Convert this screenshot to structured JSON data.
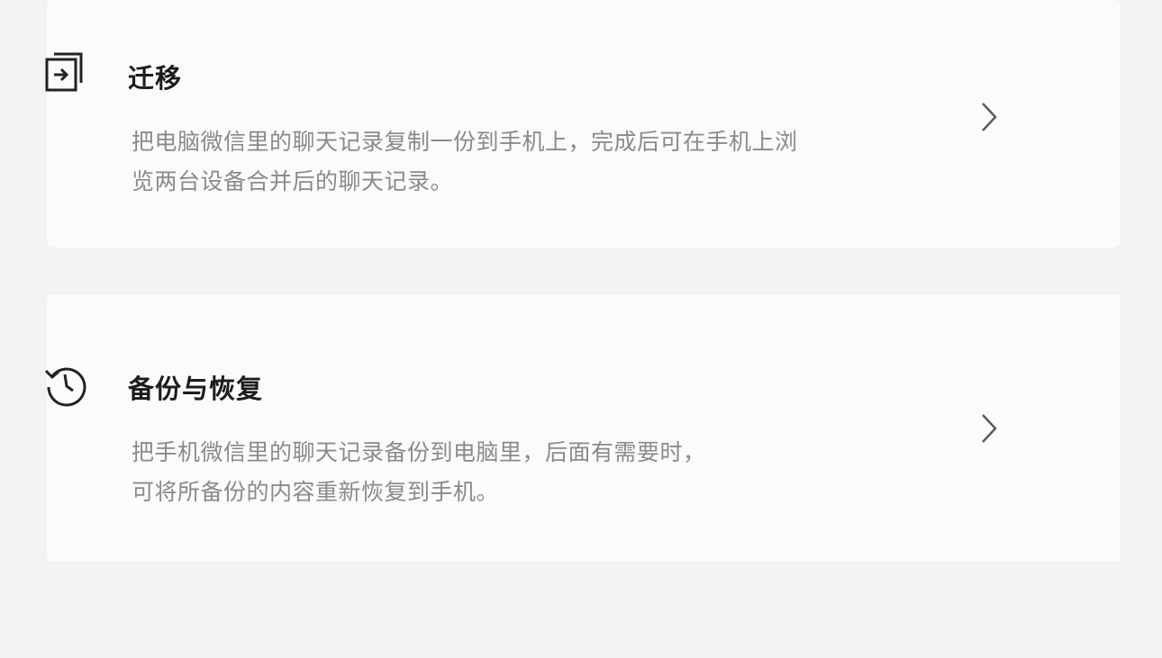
{
  "colors": {
    "background": "#f3f3f5",
    "card": "#fbfbfd",
    "title": "#1c1c1c",
    "description": "#8a8a8a",
    "chevron": "#5a5a5a"
  },
  "options": [
    {
      "icon": "migrate-icon",
      "title": "迁移",
      "description_lines": [
        "把电脑微信里的聊天记录复制一份到手机上，完成后可在手机上浏",
        "览两台设备合并后的聊天记录。"
      ]
    },
    {
      "icon": "history-clock-icon",
      "title": "备份与恢复",
      "description_lines": [
        "把手机微信里的聊天记录备份到电脑里，后面有需要时，",
        "可将所备份的内容重新恢复到手机。"
      ]
    }
  ]
}
